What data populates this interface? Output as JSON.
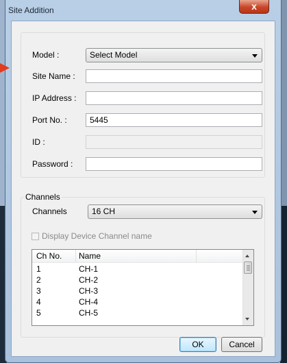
{
  "window": {
    "title": "Site Addition",
    "close_glyph": "x"
  },
  "site": {
    "model_label": "Model :",
    "model_value": "Select Model",
    "site_name_label": "Site Name :",
    "site_name_value": "",
    "ip_label": "IP Address :",
    "ip_value": "",
    "port_label": "Port No. :",
    "port_value": "5445",
    "id_label": "ID :",
    "id_value": "",
    "password_label": "Password :",
    "password_value": ""
  },
  "channels": {
    "group_title": "Channels",
    "channels_label": "Channels",
    "channels_value": "16 CH",
    "display_name_label": "Display Device Channel name",
    "display_name_checked": false,
    "columns": [
      "Ch No.",
      "Name"
    ],
    "rows": [
      {
        "no": "1",
        "name": "CH-1"
      },
      {
        "no": "2",
        "name": "CH-2"
      },
      {
        "no": "3",
        "name": "CH-3"
      },
      {
        "no": "4",
        "name": "CH-4"
      },
      {
        "no": "5",
        "name": "CH-5"
      }
    ]
  },
  "buttons": {
    "ok": "OK",
    "cancel": "Cancel"
  },
  "colors": {
    "pointer_arrow": "#e23b1e",
    "close_button": "#c8462a",
    "dialog_bg": "#f0f0f0"
  }
}
